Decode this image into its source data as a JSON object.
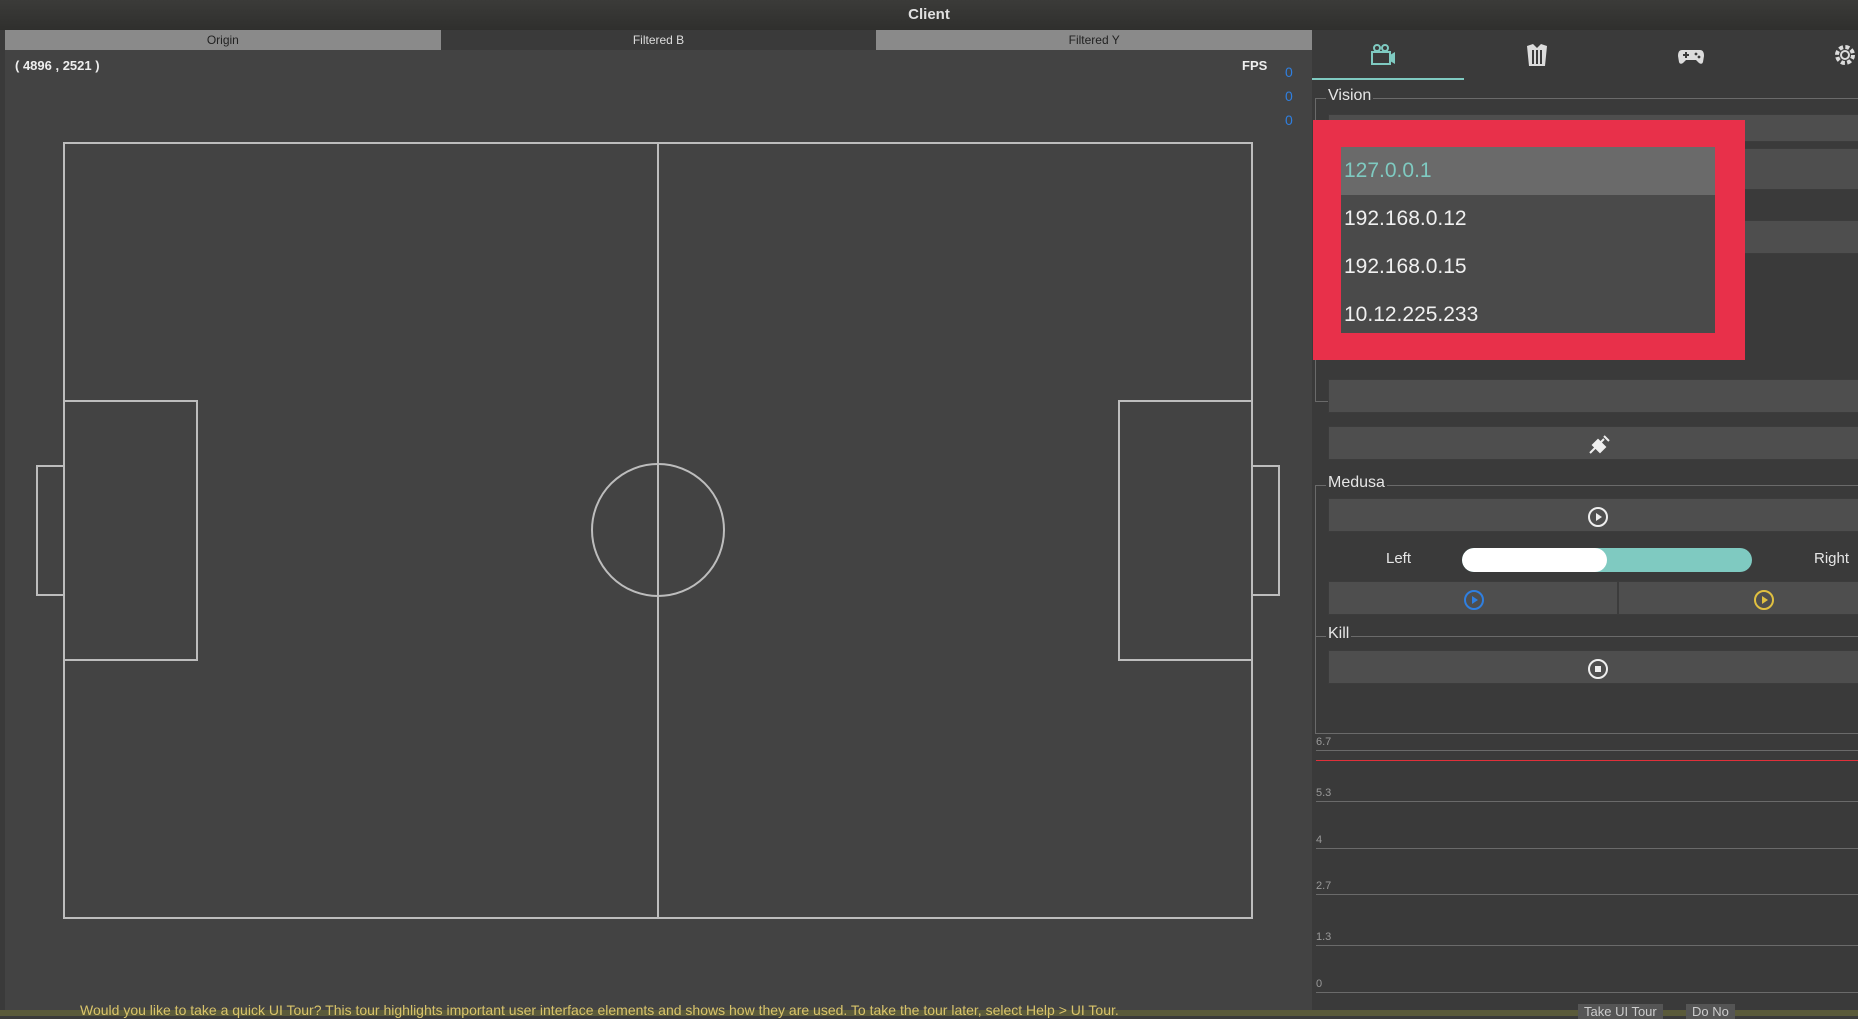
{
  "window": {
    "title": "Client"
  },
  "view_tabs": [
    {
      "label": "Origin"
    },
    {
      "label": "Filtered B"
    },
    {
      "label": "Filtered Y"
    }
  ],
  "field_view": {
    "coords": "( 4896 , 2521 )",
    "fps_label": "FPS",
    "fps_values": [
      "0",
      "0",
      "0"
    ]
  },
  "side_tabs": [
    {
      "icon": "camera-icon"
    },
    {
      "icon": "jersey-icon"
    },
    {
      "icon": "gamepad-icon"
    },
    {
      "icon": "settings-icon"
    }
  ],
  "vision": {
    "title": "Vision",
    "ip_options": [
      "127.0.0.1",
      "192.168.0.12",
      "192.168.0.15",
      "10.12.225.233"
    ],
    "selected_ip": "127.0.0.1",
    "connect_icon": "plug-icon"
  },
  "medusa": {
    "title": "Medusa",
    "left_label": "Left",
    "right_label": "Right",
    "side_slider_fraction": 0.5,
    "blue_color": "#2f7fe0",
    "yellow_color": "#e0c040"
  },
  "kill": {
    "title": "Kill"
  },
  "chart_data": {
    "type": "line",
    "y_ticks": [
      "6.7",
      "5.3",
      "4",
      "2.7",
      "1.3",
      "0"
    ],
    "ylim": [
      0,
      6.7
    ],
    "threshold_color": "#e0303a"
  },
  "status_bar": {
    "message": "Would you like to take a quick UI Tour? This tour highlights important user interface elements and shows how they are used. To take the tour later, select Help > UI Tour.",
    "take_tour_label": "Take UI Tour",
    "no_label": "Do No"
  }
}
